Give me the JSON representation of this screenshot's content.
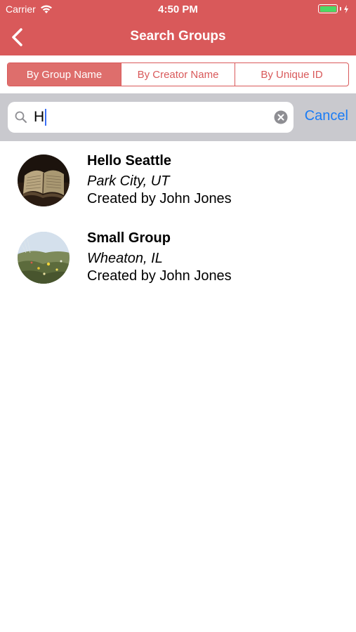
{
  "status": {
    "carrier": "Carrier",
    "time": "4:50 PM"
  },
  "nav": {
    "title": "Search Groups"
  },
  "segments": [
    {
      "label": "By Group Name"
    },
    {
      "label": "By Creator Name"
    },
    {
      "label": "By Unique ID"
    }
  ],
  "search": {
    "query": "H",
    "cancel_label": "Cancel"
  },
  "results": [
    {
      "name": "Hello Seattle",
      "location": "Park City, UT",
      "creator": "Created by John Jones"
    },
    {
      "name": "Small Group",
      "location": "Wheaton, IL",
      "creator": "Created by John Jones"
    }
  ],
  "colors": {
    "accent": "#d9595a",
    "link": "#1a7cf5"
  }
}
